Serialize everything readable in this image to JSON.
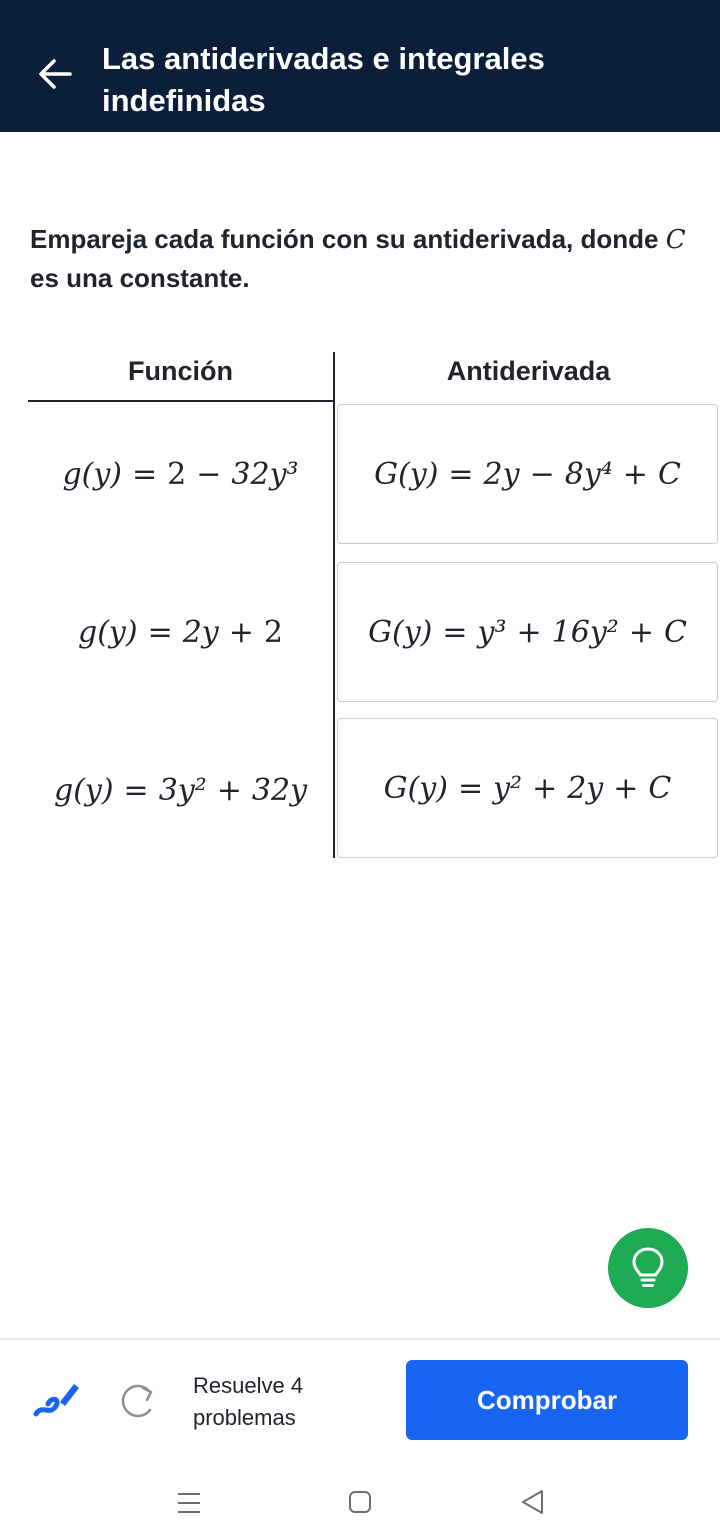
{
  "header": {
    "title": "Las antiderivadas e integrales indefinidas"
  },
  "prompt": {
    "text_before": "Empareja cada función con su antiderivada, donde ",
    "variable": "C",
    "text_after": " es una constante."
  },
  "table": {
    "left_header": "Función",
    "right_header": "Antiderivada",
    "functions": [
      {
        "lhs": "g(y)",
        "parts": [
          "2",
          "−",
          "32y³"
        ]
      },
      {
        "lhs": "g(y)",
        "parts": [
          "2y",
          "+",
          "2"
        ]
      },
      {
        "lhs": "g(y)",
        "parts": [
          "3y²",
          "+",
          "32y"
        ]
      }
    ],
    "antiderivatives": [
      {
        "lhs": "G(y)",
        "parts": [
          "2y",
          "−",
          "8y⁴",
          "+",
          "C"
        ]
      },
      {
        "lhs": "G(y)",
        "parts": [
          "y³",
          "+",
          "16y²",
          "+",
          "C"
        ]
      },
      {
        "lhs": "G(y)",
        "parts": [
          "y²",
          "+",
          "2y",
          "+",
          "C"
        ]
      }
    ]
  },
  "footer": {
    "progress_line1": "Resuelve 4",
    "progress_line2": "problemas",
    "check_label": "Comprobar"
  },
  "colors": {
    "header_bg": "#0b1f3a",
    "primary_button": "#1865f2",
    "hint_button": "#1fab54"
  },
  "icons": [
    "arrow-left-icon",
    "lightbulb-icon",
    "pencil-icon",
    "redo-icon",
    "menu-icon",
    "home-icon",
    "back-triangle-icon"
  ]
}
